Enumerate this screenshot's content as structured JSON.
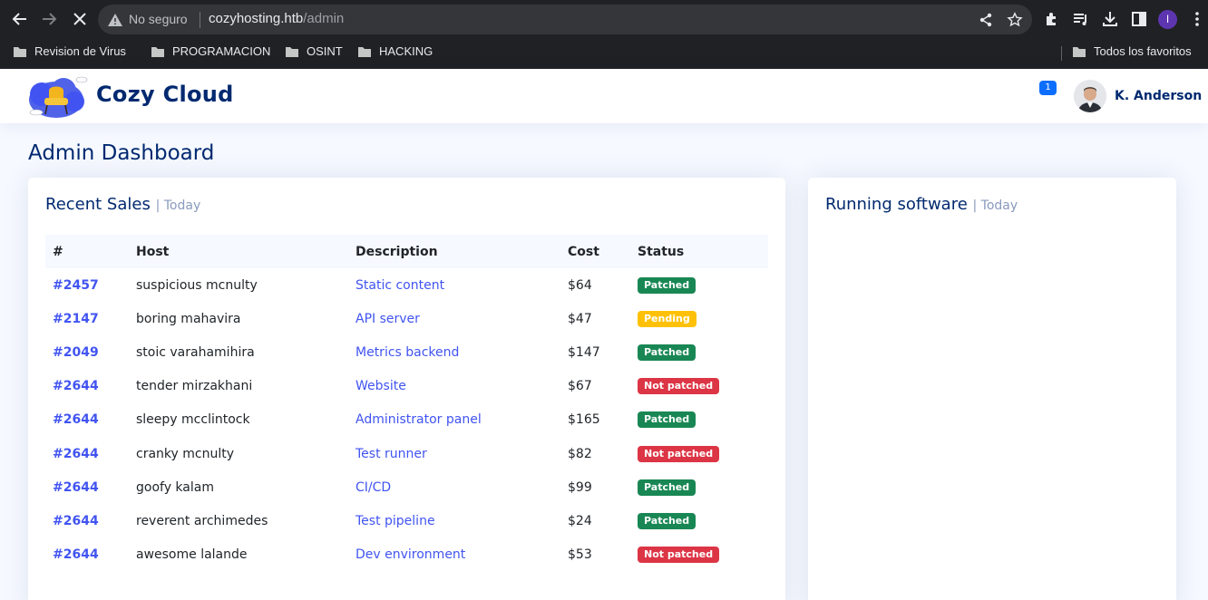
{
  "browser": {
    "security_label": "No seguro",
    "url_host": "cozyhosting.htb",
    "url_path": "/admin",
    "profile_initial": "I",
    "bookmarks": [
      {
        "label": "Revision de Virus"
      },
      {
        "label": "PROGRAMACION"
      },
      {
        "label": "OSINT"
      },
      {
        "label": "HACKING"
      }
    ],
    "all_bookmarks_label": "Todos los favoritos"
  },
  "header": {
    "brand": "Cozy Cloud",
    "notification_count": "1",
    "user_name": "K. Anderson"
  },
  "main": {
    "page_title": "Admin Dashboard",
    "recent_sales": {
      "title": "Recent Sales",
      "subtitle": "| Today",
      "columns": [
        "#",
        "Host",
        "Description",
        "Cost",
        "Status"
      ],
      "rows": [
        {
          "id": "#2457",
          "host": "suspicious mcnulty",
          "description": "Static content",
          "cost": "$64",
          "status": "Patched",
          "status_type": "patched"
        },
        {
          "id": "#2147",
          "host": "boring mahavira",
          "description": "API server",
          "cost": "$47",
          "status": "Pending",
          "status_type": "pending"
        },
        {
          "id": "#2049",
          "host": "stoic varahamihira",
          "description": "Metrics backend",
          "cost": "$147",
          "status": "Patched",
          "status_type": "patched"
        },
        {
          "id": "#2644",
          "host": "tender mirzakhani",
          "description": "Website",
          "cost": "$67",
          "status": "Not patched",
          "status_type": "notpatched"
        },
        {
          "id": "#2644",
          "host": "sleepy mcclintock",
          "description": "Administrator panel",
          "cost": "$165",
          "status": "Patched",
          "status_type": "patched"
        },
        {
          "id": "#2644",
          "host": "cranky mcnulty",
          "description": "Test runner",
          "cost": "$82",
          "status": "Not patched",
          "status_type": "notpatched"
        },
        {
          "id": "#2644",
          "host": "goofy kalam",
          "description": "CI/CD",
          "cost": "$99",
          "status": "Patched",
          "status_type": "patched"
        },
        {
          "id": "#2644",
          "host": "reverent archimedes",
          "description": "Test pipeline",
          "cost": "$24",
          "status": "Patched",
          "status_type": "patched"
        },
        {
          "id": "#2644",
          "host": "awesome lalande",
          "description": "Dev environment",
          "cost": "$53",
          "status": "Not patched",
          "status_type": "notpatched"
        }
      ]
    },
    "running_software": {
      "title": "Running software",
      "subtitle": "| Today"
    }
  },
  "colors": {
    "brand_navy": "#012970",
    "link_blue": "#4154f1",
    "patched": "#198754",
    "pending": "#ffc107",
    "not_patched": "#dc3545"
  }
}
